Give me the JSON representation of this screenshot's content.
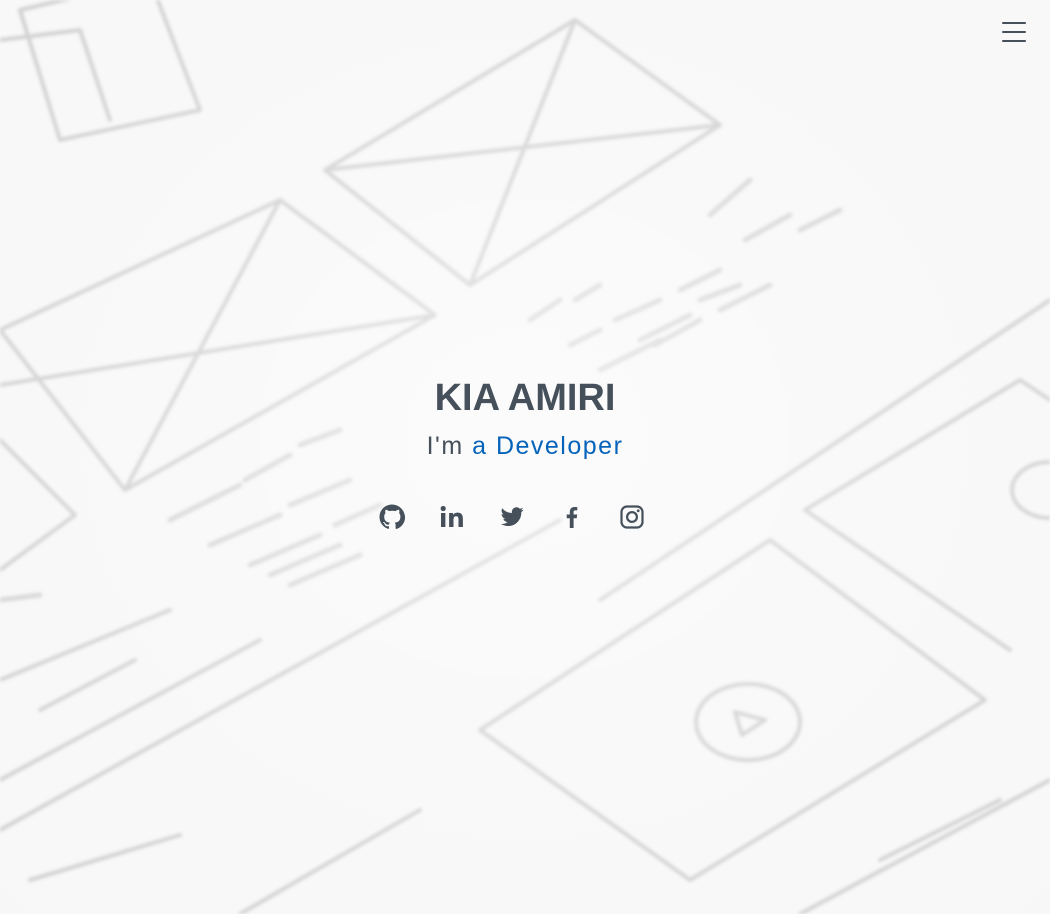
{
  "hero": {
    "name": "KIA AMIRI",
    "tagline_prefix": "I'm",
    "tagline_typed": "a Developer"
  },
  "social": [
    {
      "icon": "github-icon"
    },
    {
      "icon": "linkedin-icon"
    },
    {
      "icon": "twitter-icon"
    },
    {
      "icon": "facebook-icon"
    },
    {
      "icon": "instagram-icon"
    }
  ],
  "colors": {
    "text": "#45505b",
    "accent": "#0563bb",
    "background": "#f7f7f7"
  }
}
